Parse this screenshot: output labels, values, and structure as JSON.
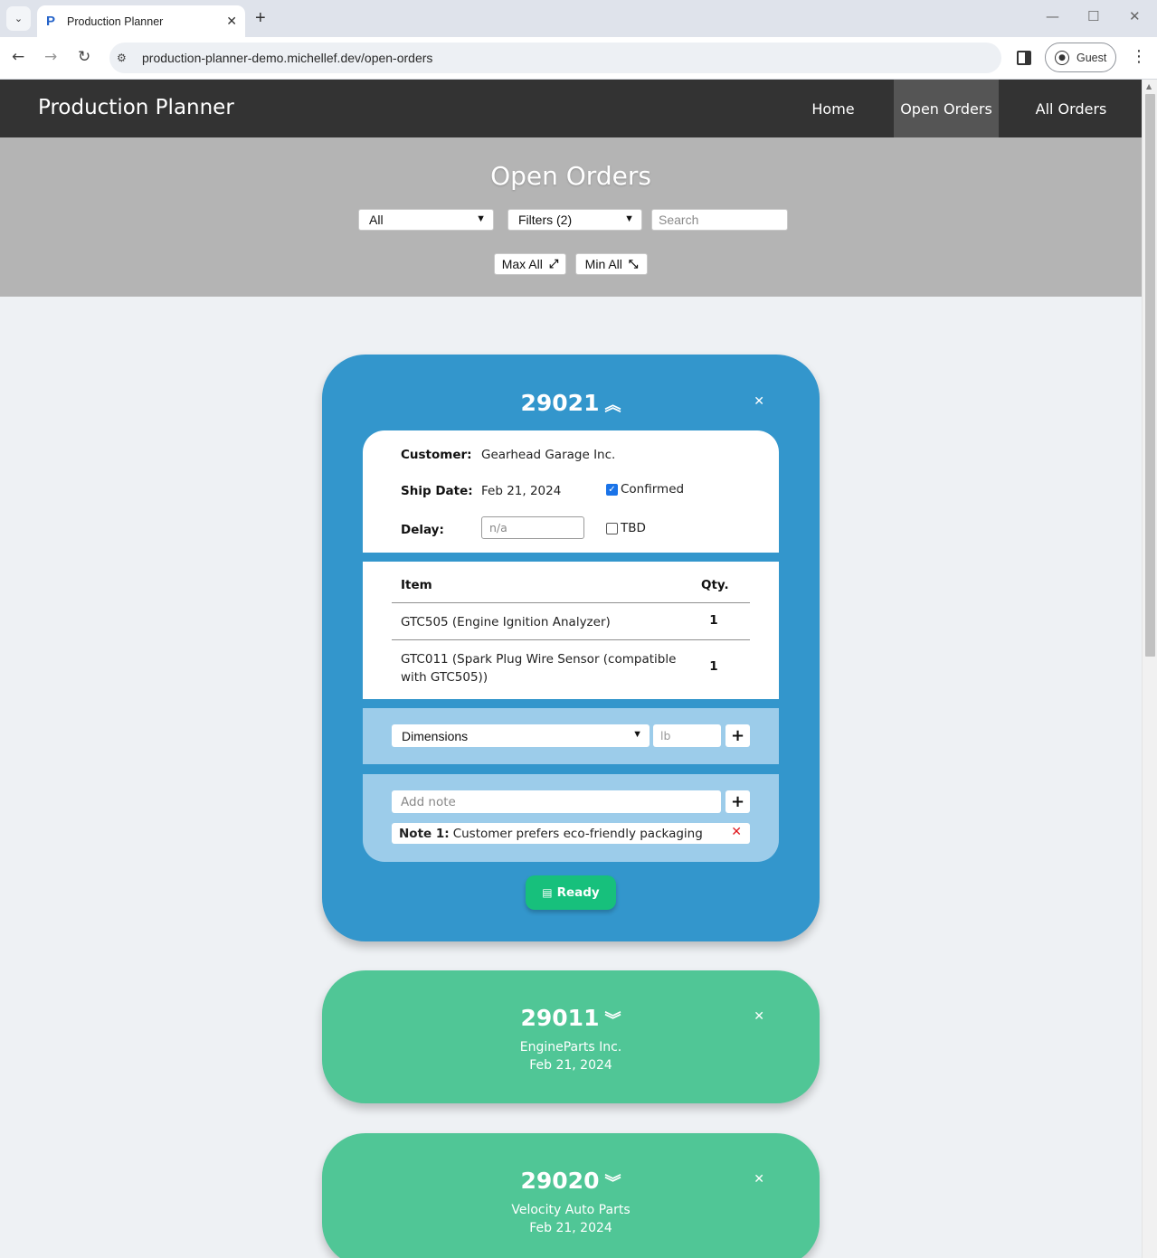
{
  "browser": {
    "tab_title": "Production Planner",
    "tab_favicon": "P",
    "url": "production-planner-demo.michellef.dev/open-orders",
    "profile_label": "Guest"
  },
  "app": {
    "brand": "Production Planner",
    "nav": [
      "Home",
      "Open Orders",
      "All Orders"
    ],
    "active_nav": "Open Orders"
  },
  "hero": {
    "title": "Open Orders",
    "status_filter": "All",
    "filters_label": "Filters (2)",
    "search_placeholder": "Search",
    "max_all": "Max All",
    "min_all": "Min All"
  },
  "expanded_order": {
    "number": "29021",
    "customer_label": "Customer:",
    "customer": "Gearhead Garage Inc.",
    "ship_date_label": "Ship Date:",
    "ship_date": "Feb 21, 2024",
    "confirmed_label": "Confirmed",
    "confirmed": true,
    "delay_label": "Delay:",
    "delay_placeholder": "n/a",
    "tbd_label": "TBD",
    "tbd": false,
    "items_header": "Item",
    "qty_header": "Qty.",
    "items": [
      {
        "name": "GTC505 (Engine Ignition Analyzer)",
        "qty": "1"
      },
      {
        "name": "GTC011 (Spark Plug Wire Sensor (compatible with GTC505))",
        "qty": "1"
      }
    ],
    "dimensions_select": "Dimensions",
    "weight_placeholder": "lb",
    "note_placeholder": "Add note",
    "notes": [
      {
        "label": "Note 1:",
        "text": "Customer prefers eco-friendly packaging"
      }
    ],
    "ready_label": "Ready"
  },
  "collapsed_orders": [
    {
      "number": "29011",
      "customer": "EngineParts Inc.",
      "ship_date": "Feb 21, 2024"
    },
    {
      "number": "29020",
      "customer": "Velocity Auto Parts",
      "ship_date": "Feb 21, 2024"
    }
  ],
  "colors": {
    "expanded_card": "#3396cc",
    "collapsed_card": "#50c696",
    "ready_button": "#17c07c",
    "navbar": "#333333",
    "hero": "#b4b4b4"
  },
  "icons": {
    "expand": "double-chevron-down-icon",
    "collapse": "double-chevron-up-icon",
    "close": "close-icon",
    "ready": "calendar-icon"
  }
}
